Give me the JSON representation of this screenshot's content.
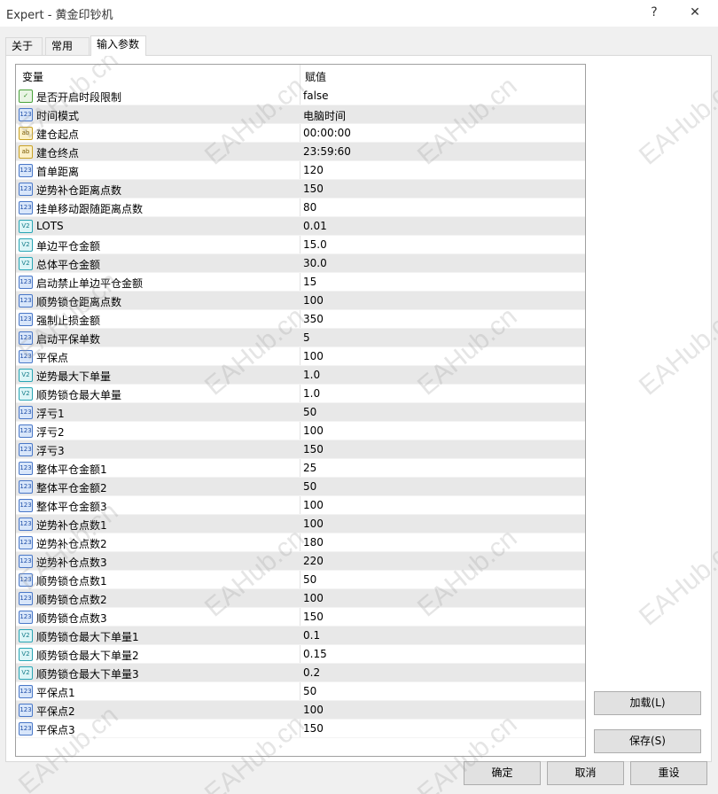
{
  "window": {
    "title": "Expert - 黄金印钞机",
    "help_glyph": "?",
    "close_glyph": "✕"
  },
  "tabs": [
    {
      "label": "关于"
    },
    {
      "label": "常用"
    },
    {
      "label": "输入参数"
    }
  ],
  "grid": {
    "col_variable": "变量",
    "col_value": "赋值",
    "rows": [
      {
        "type": "bool",
        "icon": "bool-icon",
        "name": "是否开启时段限制",
        "value": "false"
      },
      {
        "type": "int",
        "icon": "int-icon",
        "name": "时间模式",
        "value": "电脑时间"
      },
      {
        "type": "str",
        "icon": "string-icon",
        "name": "建仓起点",
        "value": "00:00:00"
      },
      {
        "type": "str",
        "icon": "string-icon",
        "name": "建仓终点",
        "value": "23:59:60"
      },
      {
        "type": "int",
        "icon": "int-icon",
        "name": "首单距离",
        "value": "120"
      },
      {
        "type": "int",
        "icon": "int-icon",
        "name": "逆势补仓距离点数",
        "value": "150"
      },
      {
        "type": "int",
        "icon": "int-icon",
        "name": "挂单移动跟随距离点数",
        "value": "80"
      },
      {
        "type": "dbl",
        "icon": "double-icon",
        "name": "LOTS",
        "value": "0.01"
      },
      {
        "type": "dbl",
        "icon": "double-icon",
        "name": "单边平仓金额",
        "value": "15.0"
      },
      {
        "type": "dbl",
        "icon": "double-icon",
        "name": "总体平仓金额",
        "value": "30.0"
      },
      {
        "type": "int",
        "icon": "int-icon",
        "name": "启动禁止单边平仓金额",
        "value": "15"
      },
      {
        "type": "int",
        "icon": "int-icon",
        "name": "顺势锁仓距离点数",
        "value": "100"
      },
      {
        "type": "int",
        "icon": "int-icon",
        "name": "强制止损金额",
        "value": "350"
      },
      {
        "type": "int",
        "icon": "int-icon",
        "name": "启动平保单数",
        "value": "5"
      },
      {
        "type": "int",
        "icon": "int-icon",
        "name": "平保点",
        "value": "100"
      },
      {
        "type": "dbl",
        "icon": "double-icon",
        "name": "逆势最大下单量",
        "value": "1.0"
      },
      {
        "type": "dbl",
        "icon": "double-icon",
        "name": "顺势锁仓最大单量",
        "value": "1.0"
      },
      {
        "type": "int",
        "icon": "int-icon",
        "name": "浮亏1",
        "value": "50"
      },
      {
        "type": "int",
        "icon": "int-icon",
        "name": "浮亏2",
        "value": "100"
      },
      {
        "type": "int",
        "icon": "int-icon",
        "name": "浮亏3",
        "value": "150"
      },
      {
        "type": "int",
        "icon": "int-icon",
        "name": "整体平仓金额1",
        "value": "25"
      },
      {
        "type": "int",
        "icon": "int-icon",
        "name": "整体平仓金额2",
        "value": "50"
      },
      {
        "type": "int",
        "icon": "int-icon",
        "name": "整体平仓金额3",
        "value": "100"
      },
      {
        "type": "int",
        "icon": "int-icon",
        "name": "逆势补仓点数1",
        "value": "100"
      },
      {
        "type": "int",
        "icon": "int-icon",
        "name": "逆势补仓点数2",
        "value": "180"
      },
      {
        "type": "int",
        "icon": "int-icon",
        "name": "逆势补仓点数3",
        "value": "220"
      },
      {
        "type": "int",
        "icon": "int-icon",
        "name": "顺势锁仓点数1",
        "value": "50"
      },
      {
        "type": "int",
        "icon": "int-icon",
        "name": "顺势锁仓点数2",
        "value": "100"
      },
      {
        "type": "int",
        "icon": "int-icon",
        "name": "顺势锁仓点数3",
        "value": "150"
      },
      {
        "type": "dbl",
        "icon": "double-icon",
        "name": "顺势锁仓最大下单量1",
        "value": "0.1"
      },
      {
        "type": "dbl",
        "icon": "double-icon",
        "name": "顺势锁仓最大下单量2",
        "value": "0.15"
      },
      {
        "type": "dbl",
        "icon": "double-icon",
        "name": "顺势锁仓最大下单量3",
        "value": "0.2"
      },
      {
        "type": "int",
        "icon": "int-icon",
        "name": "平保点1",
        "value": "50"
      },
      {
        "type": "int",
        "icon": "int-icon",
        "name": "平保点2",
        "value": "100"
      },
      {
        "type": "int",
        "icon": "int-icon",
        "name": "平保点3",
        "value": "150"
      }
    ]
  },
  "icon_glyphs": {
    "bool": "✓",
    "int": "123",
    "str": "ab",
    "dbl": "V2"
  },
  "buttons": {
    "load": "加载(L)",
    "save": "保存(S)",
    "ok": "确定",
    "cancel": "取消",
    "reset": "重设"
  },
  "watermark_text": "EAHub.cn"
}
